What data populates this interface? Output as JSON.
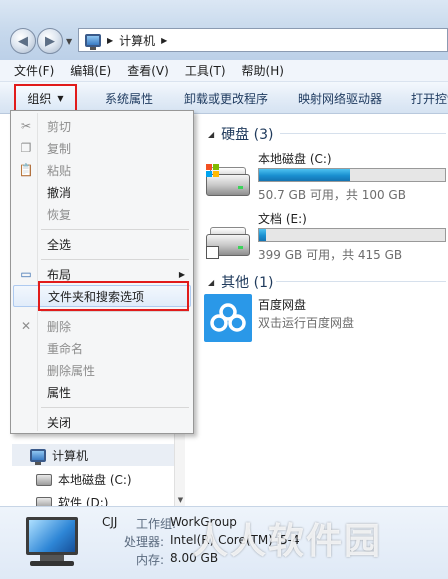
{
  "address": {
    "location": "计算机"
  },
  "menubar": {
    "items": [
      "文件(F)",
      "编辑(E)",
      "查看(V)",
      "工具(T)",
      "帮助(H)"
    ]
  },
  "toolbar": {
    "organize": "组织",
    "system_properties": "系统属性",
    "uninstall": "卸载或更改程序",
    "map_drive": "映射网络驱动器",
    "open_control": "打开控制"
  },
  "organize_menu": {
    "cut": "剪切",
    "copy": "复制",
    "paste": "粘贴",
    "undo": "撤消",
    "redo": "恢复",
    "select_all": "全选",
    "layout": "布局",
    "folder_options": "文件夹和搜索选项",
    "delete": "删除",
    "rename": "重命名",
    "remove_properties": "删除属性",
    "properties": "属性",
    "close": "关闭"
  },
  "groups": {
    "hard_disks": "硬盘 (3)",
    "other": "其他 (1)"
  },
  "drives": [
    {
      "name": "本地磁盘 (C:)",
      "size_text": "50.7 GB 可用，共 100 GB",
      "used_fraction": 0.49
    },
    {
      "name": "文档 (E:)",
      "size_text": "399 GB 可用，共 415 GB",
      "used_fraction": 0.04
    }
  ],
  "apps": [
    {
      "name": "百度网盘",
      "description": "双击运行百度网盘"
    }
  ],
  "nav_tree": {
    "computer": "计算机",
    "local_disk": "本地磁盘 (C:)",
    "software": "软件 (D:)"
  },
  "details": {
    "name": "CJJ",
    "workgroup_label": "工作组:",
    "workgroup_value": "WorkGroup",
    "processor_label": "处理器:",
    "processor_value": "Intel(R) Core(TM) i5-4",
    "memory_label": "内存:",
    "memory_value": "8.00 GB"
  },
  "watermark": "人人软件园",
  "colors": {
    "highlight_box": "#e11b1b",
    "progress_fill": "#1a8fd0",
    "baidu_blue": "#2a98e8"
  }
}
